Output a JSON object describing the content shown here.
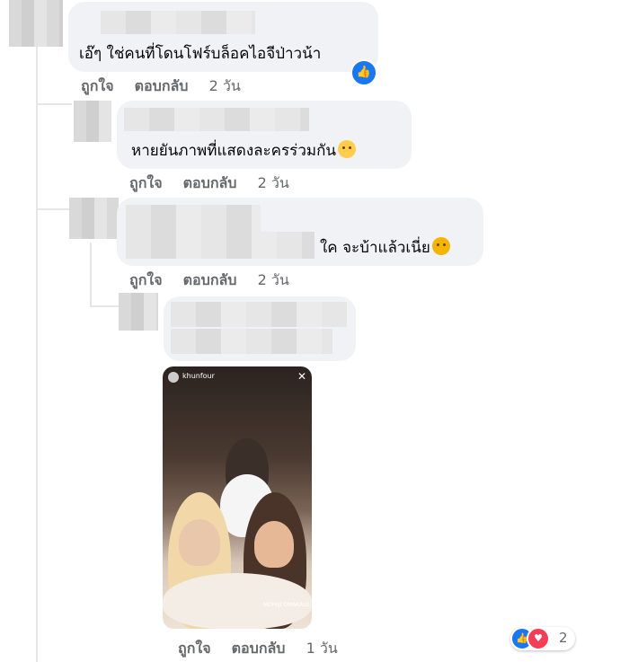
{
  "comments": [
    {
      "text": "เอ๊ๆ ใช่คนที่โดนโฟร์บล็อคไอจีป่าวน้า",
      "actions": {
        "like": "ถูกใจ",
        "reply": "ตอบกลับ",
        "time": "2 วัน"
      }
    },
    {
      "text": "หายยันภาพที่แสดงละครร่วมกัน",
      "actions": {
        "like": "ถูกใจ",
        "reply": "ตอบกลับ",
        "time": "2 วัน"
      }
    },
    {
      "text": "ใค จะบ้าแล้วเนี่ย",
      "actions": {
        "like": "ถูกใจ",
        "reply": "ตอบกลับ",
        "time": "2 วัน"
      }
    },
    {
      "text": "",
      "actions": {
        "like": "ถูกใจ",
        "reply": "ตอบกลับ",
        "time": "1 วัน"
      }
    }
  ],
  "photo": {
    "username": "khunfour",
    "caption": "MOMIJI OMAKASE"
  },
  "reactions": {
    "count": "2",
    "icons": [
      "like-icon",
      "love-icon"
    ]
  },
  "colors": {
    "bubble": "#f0f2f5",
    "like_blue": "#1877f2",
    "love_red": "#f33e58",
    "meta_gray": "#65676b"
  }
}
